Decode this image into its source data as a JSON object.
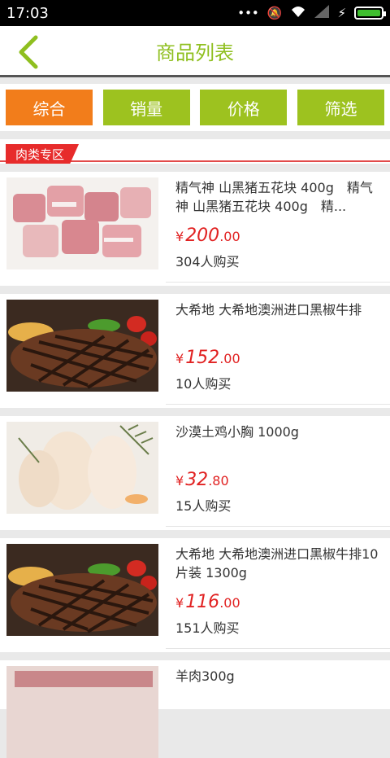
{
  "status": {
    "time": "17:03",
    "dots": "•••"
  },
  "header": {
    "title": "商品列表"
  },
  "tabs": [
    {
      "label": "综合",
      "active": true
    },
    {
      "label": "销量"
    },
    {
      "label": "价格"
    },
    {
      "label": "筛选"
    }
  ],
  "section": {
    "title": "肉类专区"
  },
  "products": [
    {
      "name": "精气神 山黑猪五花块 400g　精气神 山黑猪五花块 400g　精...",
      "currency": "¥",
      "price_int": "200",
      "price_dec": ".00",
      "sold": "304人购买",
      "image": "pork-cubes"
    },
    {
      "name": "大希地 大希地澳洲进口黑椒牛排",
      "currency": "¥",
      "price_int": "152",
      "price_dec": ".00",
      "sold": "10人购买",
      "image": "steak"
    },
    {
      "name": "沙漠土鸡小胸 1000g",
      "currency": "¥",
      "price_int": "32",
      "price_dec": ".80",
      "sold": "15人购买",
      "image": "chicken-breast"
    },
    {
      "name": "大希地 大希地澳洲进口黑椒牛排10片装 1300g",
      "currency": "¥",
      "price_int": "116",
      "price_dec": ".00",
      "sold": "151人购买",
      "image": "steak"
    },
    {
      "name": "羊肉300g",
      "image": "mutton"
    }
  ],
  "colors": {
    "accent_green": "#8fbf1f",
    "tab_green": "#9dc21f",
    "tab_orange": "#f27d1b",
    "price_red": "#e12222",
    "section_red": "#e72b2b"
  }
}
